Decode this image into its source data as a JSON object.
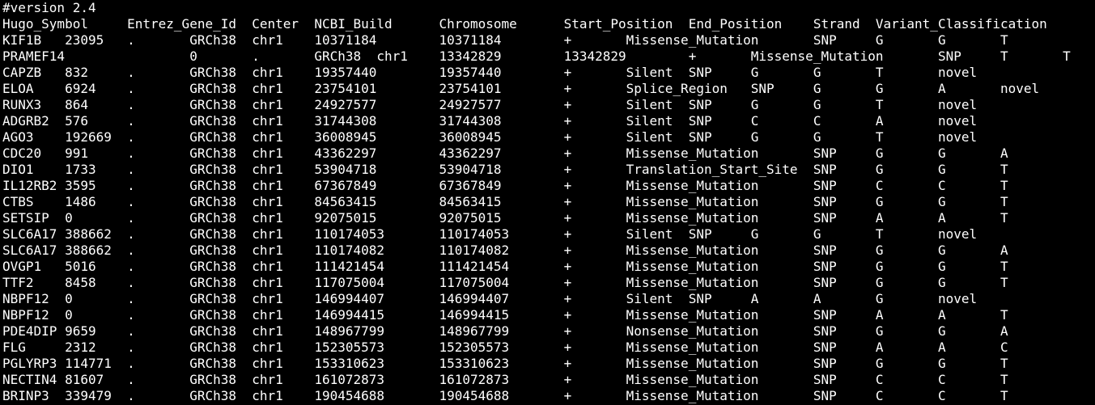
{
  "colors": {
    "background": "#000000",
    "foreground": "#ffffff"
  },
  "terminal": {
    "lines": [
      "#version 2.4",
      "Hugo_Symbol     Entrez_Gene_Id  Center  NCBI_Build      Chromosome      Start_Position  End_Position    Strand  Variant_Classification",
      "KIF1B   23095   .       GRCh38  chr1    10371184        10371184        +       Missense_Mutation       SNP     G       G       T",
      "PRAMEF14                0       .       GRCh38  chr1    13342829        13342829        +       Missense_Mutation       SNP     T       T",
      "CAPZB   832     .       GRCh38  chr1    19357440        19357440        +       Silent  SNP     G       G       T       novel",
      "ELOA    6924    .       GRCh38  chr1    23754101        23754101        +       Splice_Region   SNP     G       G       A       novel",
      "RUNX3   864     .       GRCh38  chr1    24927577        24927577        +       Silent  SNP     G       G       T       novel",
      "ADGRB2  576     .       GRCh38  chr1    31744308        31744308        +       Silent  SNP     C       C       A       novel",
      "AGO3    192669  .       GRCh38  chr1    36008945        36008945        +       Silent  SNP     G       G       T       novel",
      "CDC20   991     .       GRCh38  chr1    43362297        43362297        +       Missense_Mutation       SNP     G       G       A",
      "DIO1    1733    .       GRCh38  chr1    53904718        53904718        +       Translation_Start_Site  SNP     G       G       T",
      "IL12RB2 3595    .       GRCh38  chr1    67367849        67367849        +       Missense_Mutation       SNP     C       C       T",
      "CTBS    1486    .       GRCh38  chr1    84563415        84563415        +       Missense_Mutation       SNP     G       G       T",
      "SETSIP  0       .       GRCh38  chr1    92075015        92075015        +       Missense_Mutation       SNP     A       A       T",
      "SLC6A17 388662  .       GRCh38  chr1    110174053       110174053       +       Silent  SNP     G       G       T       novel",
      "SLC6A17 388662  .       GRCh38  chr1    110174082       110174082       +       Missense_Mutation       SNP     G       G       A",
      "OVGP1   5016    .       GRCh38  chr1    111421454       111421454       +       Missense_Mutation       SNP     G       G       T",
      "TTF2    8458    .       GRCh38  chr1    117075004       117075004       +       Missense_Mutation       SNP     G       G       T",
      "NBPF12  0       .       GRCh38  chr1    146994407       146994407       +       Silent  SNP     A       A       G       novel",
      "NBPF12  0       .       GRCh38  chr1    146994415       146994415       +       Missense_Mutation       SNP     A       A       T",
      "PDE4DIP 9659    .       GRCh38  chr1    148967799       148967799       +       Nonsense_Mutation       SNP     G       G       A",
      "FLG     2312    .       GRCh38  chr1    152305573       152305573       +       Missense_Mutation       SNP     A       A       C",
      "PGLYRP3 114771  .       GRCh38  chr1    153310623       153310623       +       Missense_Mutation       SNP     G       G       T",
      "NECTIN4 81607   .       GRCh38  chr1    161072873       161072873       +       Missense_Mutation       SNP     C       C       T",
      "BRINP3  339479  .       GRCh38  chr1    190454688       190454688       +       Missense_Mutation       SNP     C       C       T"
    ]
  }
}
